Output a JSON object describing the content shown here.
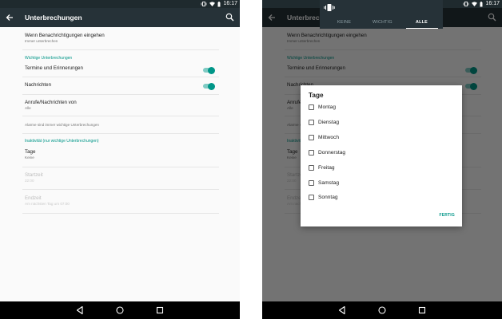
{
  "status_bar": {
    "time": "16:17"
  },
  "app_bar": {
    "title": "Unterbrechungen"
  },
  "settings": {
    "notifications_pref": {
      "title": "Wenn Benachrichtigungen eingehen",
      "summary": "Immer unterbrechen"
    },
    "priority_category": "Wichtige Unterbrechungen",
    "events_reminders": {
      "title": "Termine und Erinnerungen",
      "enabled": true
    },
    "messages": {
      "title": "Nachrichten",
      "enabled": true
    },
    "calls_messages_from": {
      "title": "Anrufe/Nachrichten von",
      "summary": "Alle"
    },
    "alarms_note": "Alarme sind immer wichtige Unterbrechungen",
    "downtime_category": "Inaktivität (nur wichtige Unterbrechungen)",
    "days": {
      "title": "Tage",
      "summary": "Keine"
    },
    "start_time": {
      "title": "Startzeit",
      "summary": "22:00"
    },
    "end_time": {
      "title": "Endzeit",
      "summary": "Am nächsten Tag um 07:00"
    }
  },
  "interruptions_shade": {
    "tabs": [
      "KEINE",
      "WICHTIG",
      "ALLE"
    ],
    "selected_tab": "ALLE"
  },
  "days_dialog": {
    "title": "Tage",
    "days": [
      {
        "label": "Montag",
        "checked": false
      },
      {
        "label": "Dienstag",
        "checked": false
      },
      {
        "label": "Mittwoch",
        "checked": false
      },
      {
        "label": "Donnerstag",
        "checked": false
      },
      {
        "label": "Freitag",
        "checked": false
      },
      {
        "label": "Samstag",
        "checked": false
      },
      {
        "label": "Sonntag",
        "checked": false
      }
    ],
    "confirm_label": "FERTIG"
  },
  "icons": {
    "back": "arrow-back-icon",
    "search": "search-icon",
    "vibrate": "vibrate-icon",
    "nav": [
      "nav-back-icon",
      "nav-home-icon",
      "nav-recents-icon"
    ]
  },
  "colors": {
    "app_bar": "#263238",
    "status_bar": "#1f2a2e",
    "accent": "#009688",
    "switch_track": "#80cbc4",
    "nav_bar": "#000000"
  }
}
